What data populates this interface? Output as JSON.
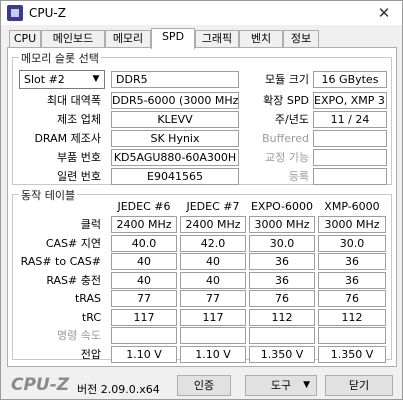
{
  "window": {
    "title": "CPU-Z",
    "close_glyph": "✕"
  },
  "tabs": [
    "CPU",
    "메인보드",
    "메모리",
    "SPD",
    "그래픽",
    "벤치",
    "정보"
  ],
  "active_tab": "SPD",
  "slot_section": {
    "title": "메모리 슬롯 선택",
    "slot_selected": "Slot #2",
    "memory_type": "DDR5",
    "labels": {
      "module_size": "모듈 크기",
      "max_bandwidth": "최대 대역폭",
      "spd_ext": "확장 SPD",
      "manufacturer": "제조 업체",
      "week_year": "주/년도",
      "dram_manufacturer": "DRAM 제조사",
      "buffered": "Buffered",
      "part_number": "부품 번호",
      "correction": "교정 기능",
      "serial_number": "일련 번호",
      "registered": "등록"
    },
    "values": {
      "module_size": "16 GBytes",
      "max_bandwidth": "DDR5-6000 (3000 MHz)",
      "spd_ext": "EXPO, XMP 3.0",
      "manufacturer": "KLEVV",
      "week_year": "11 / 24",
      "dram_manufacturer": "SK Hynix",
      "part_number": "KD5AGU880-60A300H",
      "serial_number": "E9041565"
    }
  },
  "timings": {
    "title": "동작 테이블",
    "columns": [
      "JEDEC #6",
      "JEDEC #7",
      "EXPO-6000",
      "XMP-6000"
    ],
    "rows": [
      {
        "label": "클럭",
        "values": [
          "2400 MHz",
          "2400 MHz",
          "3000 MHz",
          "3000 MHz"
        ]
      },
      {
        "label": "CAS# 지연",
        "values": [
          "40.0",
          "42.0",
          "30.0",
          "30.0"
        ]
      },
      {
        "label": "RAS# to CAS#",
        "values": [
          "40",
          "40",
          "36",
          "36"
        ]
      },
      {
        "label": "RAS# 충전",
        "values": [
          "40",
          "40",
          "36",
          "36"
        ]
      },
      {
        "label": "tRAS",
        "values": [
          "77",
          "77",
          "76",
          "76"
        ]
      },
      {
        "label": "tRC",
        "values": [
          "117",
          "117",
          "112",
          "112"
        ]
      },
      {
        "label": "명령 속도",
        "values": [
          "",
          "",
          "",
          ""
        ]
      },
      {
        "label": "전압",
        "values": [
          "1.10 V",
          "1.10 V",
          "1.350 V",
          "1.350 V"
        ]
      }
    ]
  },
  "footer": {
    "logo": "CPU-Z",
    "version": "버전 2.09.0.x64",
    "validate": "인증",
    "tools": "도구",
    "close": "닫기"
  }
}
